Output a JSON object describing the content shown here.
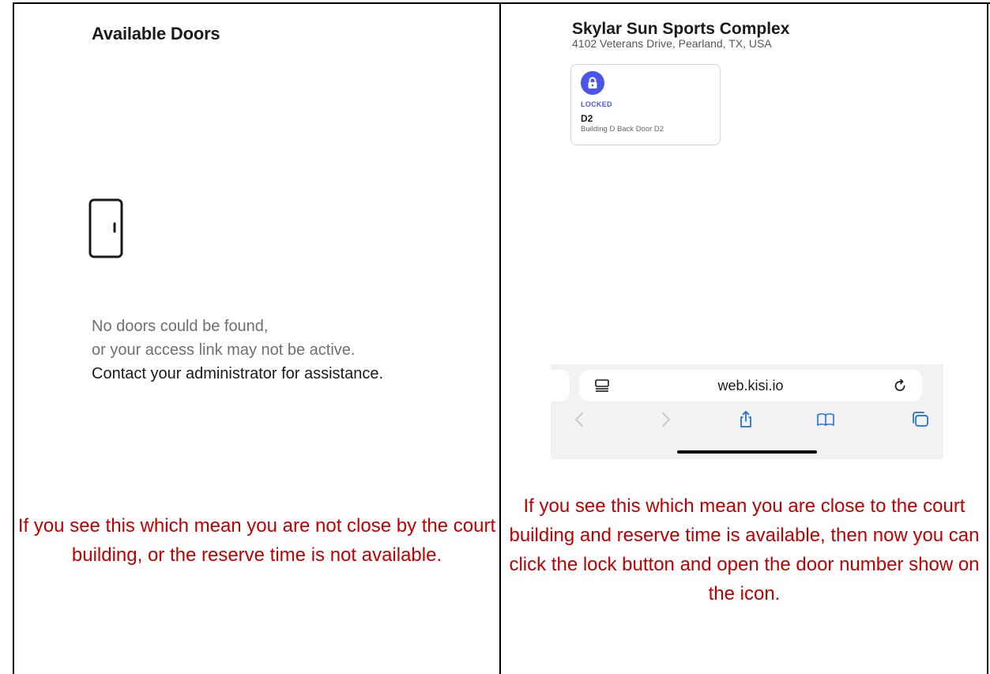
{
  "left_panel": {
    "title": "Available Doors",
    "message_line1": "No doors could be found,",
    "message_line2": "or your access link may not be active.",
    "message_line3": "Contact your administrator for assistance.",
    "caption": "If you see this which mean you are not close by the court building, or the reserve time is not available."
  },
  "right_panel": {
    "site_name": "Skylar Sun Sports Complex",
    "site_address": "4102 Veterans Drive, Pearland, TX, USA",
    "door_card": {
      "status": "LOCKED",
      "name": "D2",
      "description": "Building D Back Door D2",
      "icon": "lock-icon"
    },
    "browser": {
      "url": "web.kisi.io",
      "icons": [
        "reader-icon",
        "reload-icon",
        "back-icon",
        "forward-icon",
        "share-icon",
        "bookmarks-icon",
        "tabs-icon"
      ]
    },
    "caption": "If you see this which mean you are close to the court building and reserve time is available, then now you can click the lock button and open the door number show on the icon."
  },
  "colors": {
    "caption": "#c00000",
    "lock_accent": "#4a56e8",
    "browser_icon": "#1e6be6"
  }
}
